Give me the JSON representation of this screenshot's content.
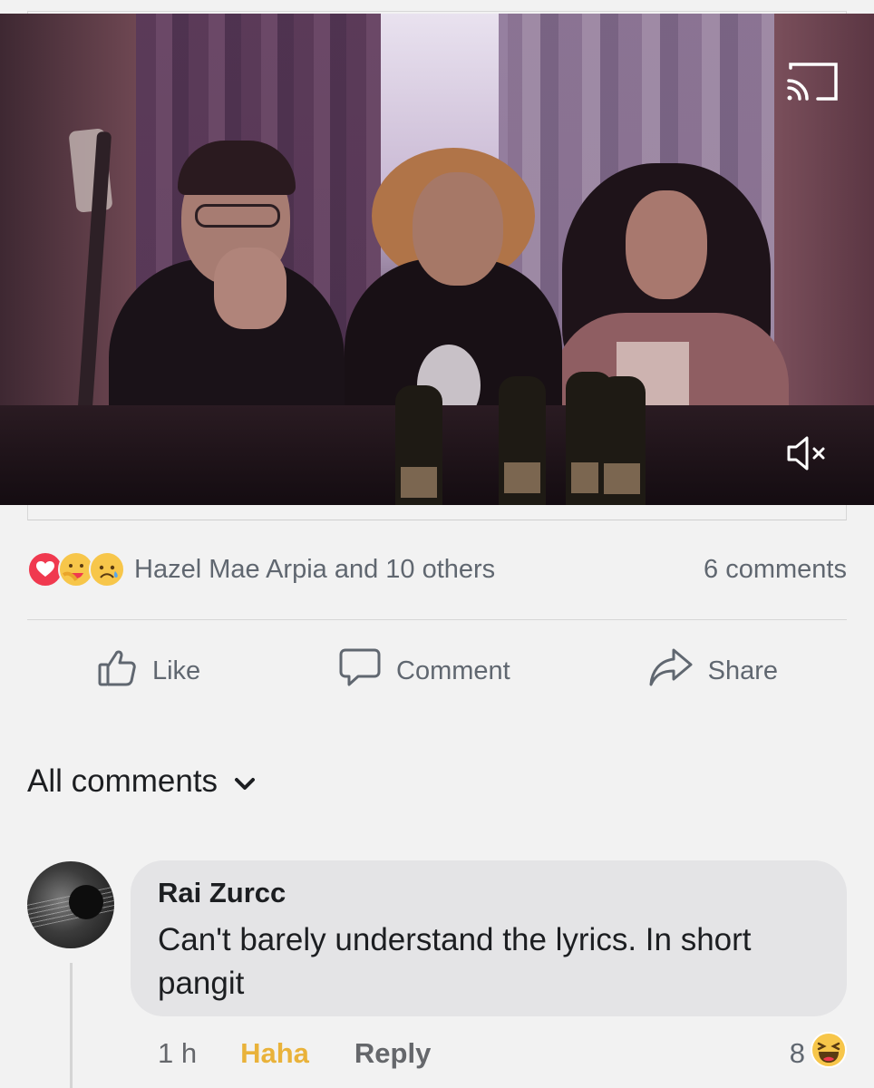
{
  "video": {
    "cast_icon": "cast-icon",
    "mute_icon": "volume-muted-icon"
  },
  "reactions": {
    "emojis": [
      "love-reaction-icon",
      "care-reaction-icon",
      "sad-reaction-icon"
    ],
    "summary": "Hazel Mae Arpia and 10 others",
    "comments_count": "6 comments"
  },
  "actions": {
    "like": "Like",
    "comment": "Comment",
    "share": "Share"
  },
  "comments_section": {
    "filter_label": "All comments"
  },
  "comment": {
    "author": "Rai Zurcc",
    "text_line1": "Can't barely understand the lyrics. In short",
    "text_line2": "pangit",
    "time": "1 h",
    "reaction_label": "Haha",
    "reply_label": "Reply",
    "reaction_count": "8"
  },
  "colors": {
    "background": "#f2f2f2",
    "bubble": "#e4e4e6",
    "muted_text": "#606770",
    "haha_accent": "#e9b23a",
    "love_red": "#f0394f"
  }
}
